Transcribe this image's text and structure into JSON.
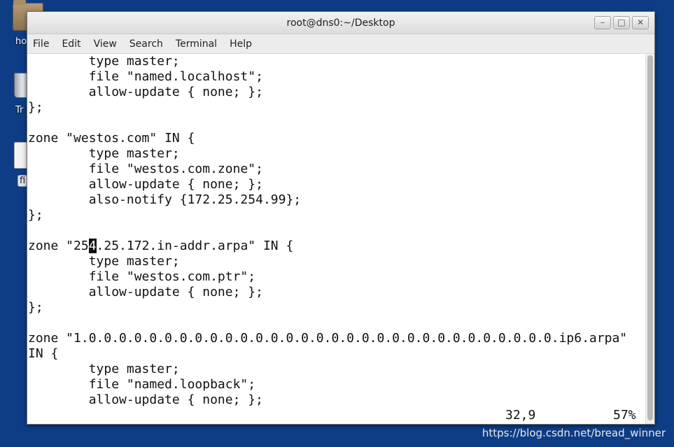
{
  "desktop": {
    "icons": [
      {
        "name": "home-folder",
        "label": "ho"
      },
      {
        "name": "trash",
        "label": "Tr"
      },
      {
        "name": "file",
        "label": "fi"
      }
    ]
  },
  "window": {
    "title": "root@dns0:~/Desktop",
    "controls": {
      "minimize": "–",
      "maximize": "□",
      "close": "✕"
    }
  },
  "menu": [
    "File",
    "Edit",
    "View",
    "Search",
    "Terminal",
    "Help"
  ],
  "terminal": {
    "lines": [
      "        type master;",
      "        file \"named.localhost\";",
      "        allow-update { none; };",
      "};",
      "",
      "zone \"westos.com\" IN {",
      "        type master;",
      "        file \"westos.com.zone\";",
      "        allow-update { none; };",
      "        also-notify {172.25.254.99};",
      "};",
      "",
      "zone \"25",
      "        type master;",
      "        file \"westos.com.ptr\";",
      "        allow-update { none; };",
      "};",
      "",
      "zone \"1.0.0.0.0.0.0.0.0.0.0.0.0.0.0.0.0.0.0.0.0.0.0.0.0.0.0.0.0.0.0.0.ip6.arpa\"",
      "IN {",
      "        type master;",
      "        file \"named.loopback\";",
      "        allow-update { none; };"
    ],
    "cursor_line": {
      "before": "zone \"25",
      "cursor_char": "4",
      "after": ".25.172.in-addr.arpa\" IN {"
    },
    "status": {
      "position": "32,9",
      "percent": "57%"
    }
  },
  "watermark": "https://blog.csdn.net/bread_winner"
}
